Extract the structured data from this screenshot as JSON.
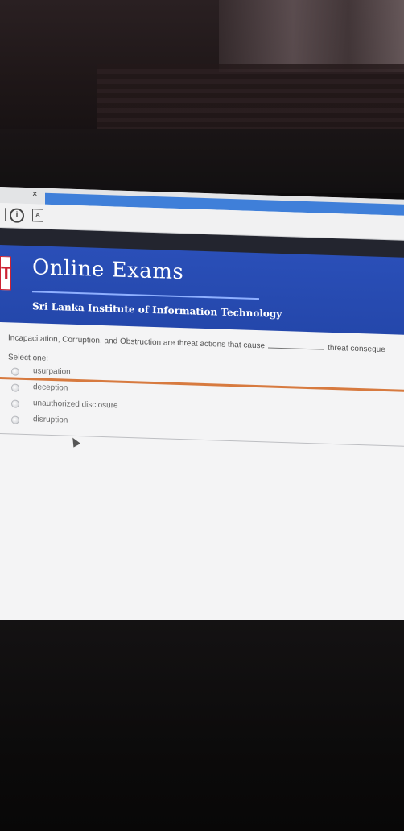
{
  "browser": {
    "tab_close": "×",
    "info_icon_glyph": "i",
    "pdf_icon_glyph": "A"
  },
  "banner": {
    "logo_glyph": "T",
    "title": "Online Exams",
    "subtitle": "Sri Lanka Institute of Information Technology"
  },
  "question": {
    "text_before": "Incapacitation, Corruption, and Obstruction are threat actions that cause",
    "text_after": "threat conseque",
    "select_prompt": "Select one:",
    "options": [
      "usurpation",
      "deception",
      "unauthorized disclosure",
      "disruption"
    ]
  }
}
